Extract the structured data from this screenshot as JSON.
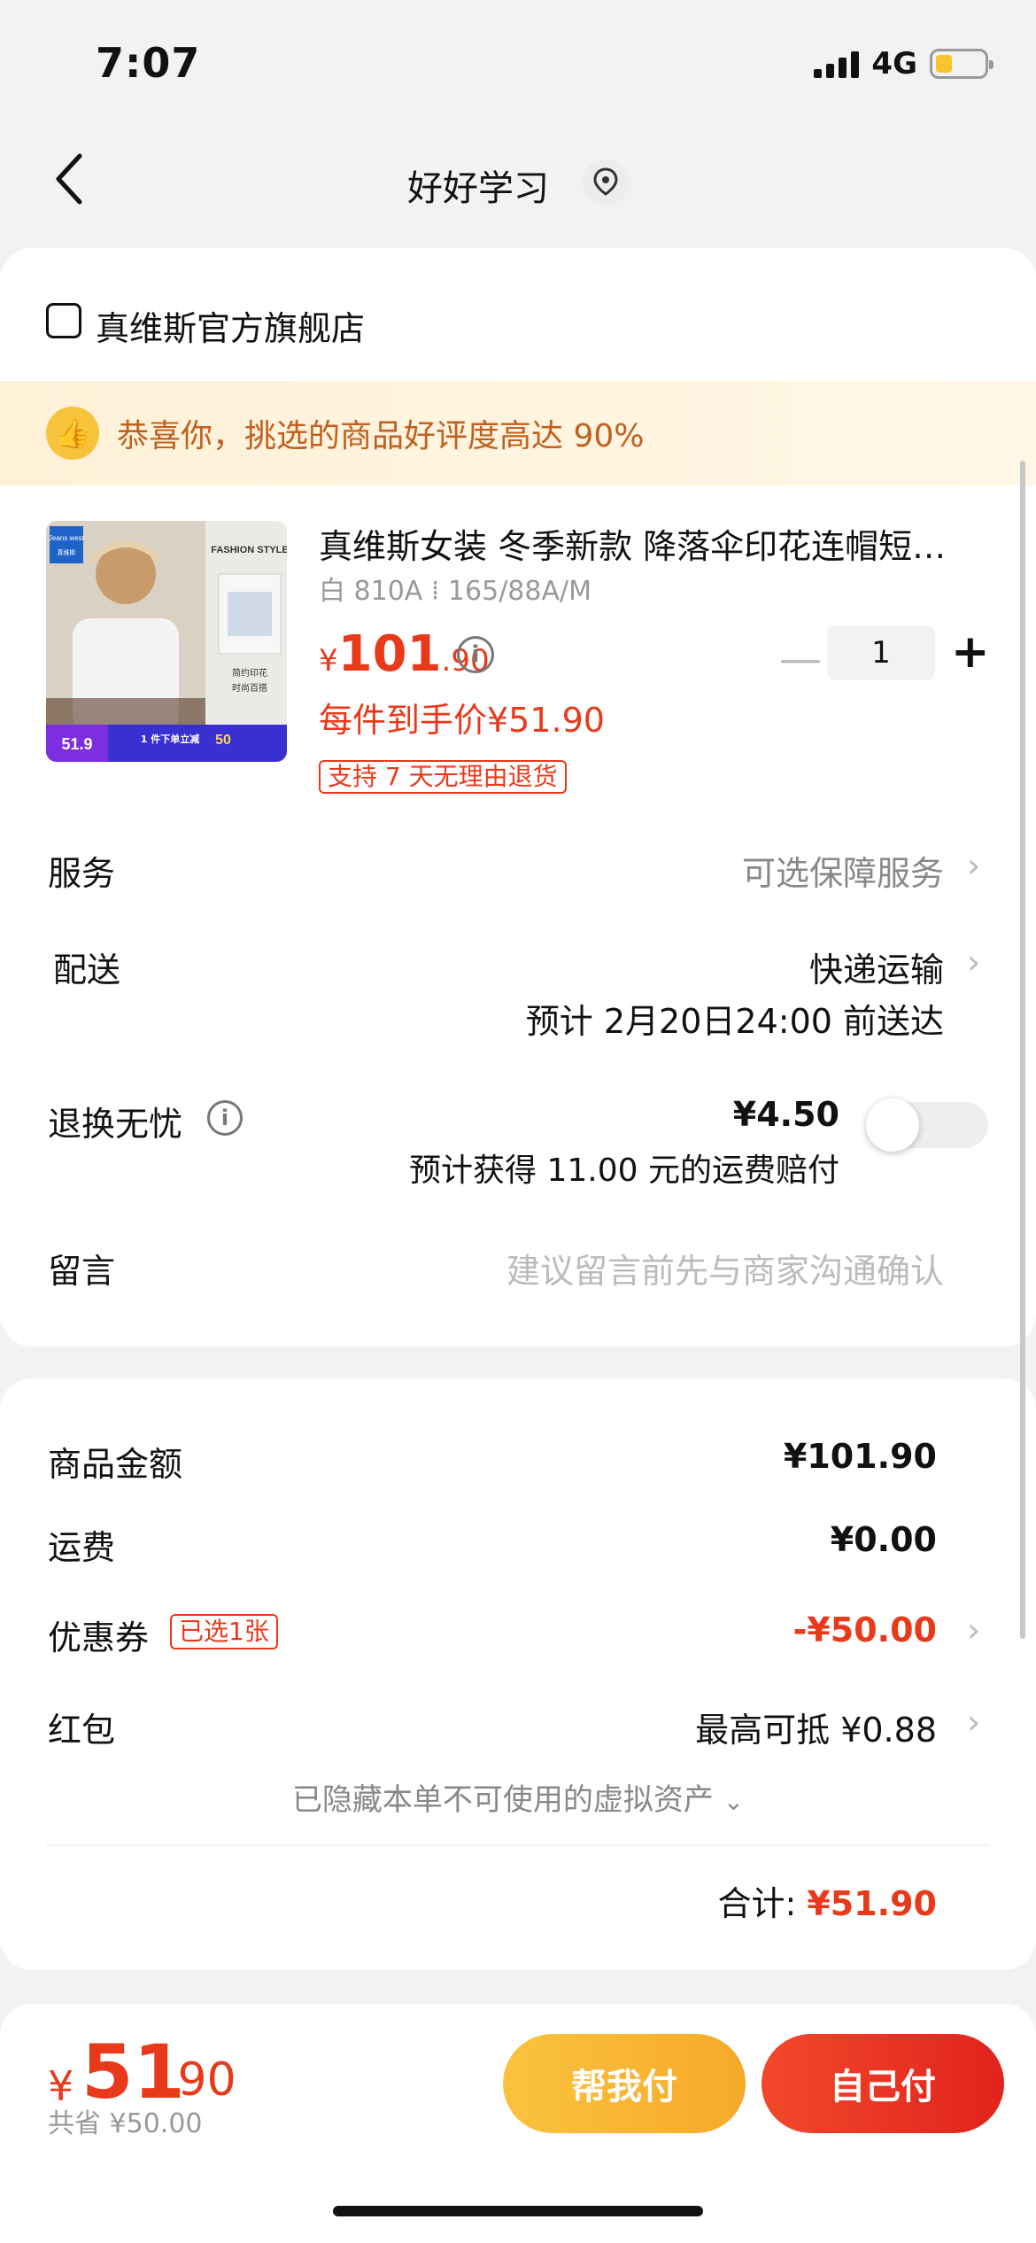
{
  "status_bar": {
    "time": "7:07",
    "network": "4G",
    "battery_level": 0.35
  },
  "nav": {
    "back_icon": "chevron-left-icon",
    "title": "好好学习",
    "location_icon": "location-pin-icon"
  },
  "store": {
    "icon": "store-icon",
    "name": "真维斯官方旗舰店"
  },
  "promo": {
    "icon": "thumbs-up-icon",
    "text": "恭喜你，挑选的商品好评度高达 90%"
  },
  "product": {
    "title": "真维斯女装 冬季新款 降落伞印花连帽短卫衣",
    "spec": "白 810A ⁞ 165/88A/M",
    "price_symbol": "¥",
    "price_int": "101",
    "price_dec": ".90",
    "unit_price": "每件到手价¥51.90",
    "return_badge": "支持 7 天无理由退货",
    "quantity": "1",
    "image": {
      "brand": "Jeans west",
      "brand_sub": "真维斯",
      "style_label": "FASHION STYLE",
      "caption1": "简约印花",
      "caption2": "时尚百搭",
      "promo_price": "51.9",
      "promo_text": "1 件下单立减",
      "promo_value": "50"
    }
  },
  "rows": {
    "service_label": "服务",
    "service_value": "可选保障服务",
    "delivery_label": "配送",
    "delivery_value": "快递运输",
    "delivery_eta": "预计 2月20日24:00 前送达",
    "return_label": "退换无忧",
    "return_price": "¥4.50",
    "return_note": "预计获得 11.00 元的运费赔付",
    "message_label": "留言",
    "message_placeholder": "建议留言前先与商家沟通确认"
  },
  "summary": {
    "goods_label": "商品金额",
    "goods_value": "¥101.90",
    "shipping_label": "运费",
    "shipping_value": "¥0.00",
    "coupon_label": "优惠券",
    "coupon_tag": "已选1张",
    "coupon_value": "-¥50.00",
    "redpacket_label": "红包",
    "redpacket_value": "最高可抵 ¥0.88",
    "hidden_assets": "已隐藏本单不可使用的虚拟资产",
    "total_label": "合计:",
    "total_value": "¥51.90"
  },
  "bottom": {
    "symbol": "¥",
    "int": "51",
    "dec": ".90",
    "saved": "共省 ¥50.00",
    "help_pay": "帮我付",
    "self_pay": "自己付"
  },
  "colors": {
    "accent_red": "#e83a1b",
    "help_yellow": "#f9c33f",
    "promo_text": "#c0601e"
  }
}
